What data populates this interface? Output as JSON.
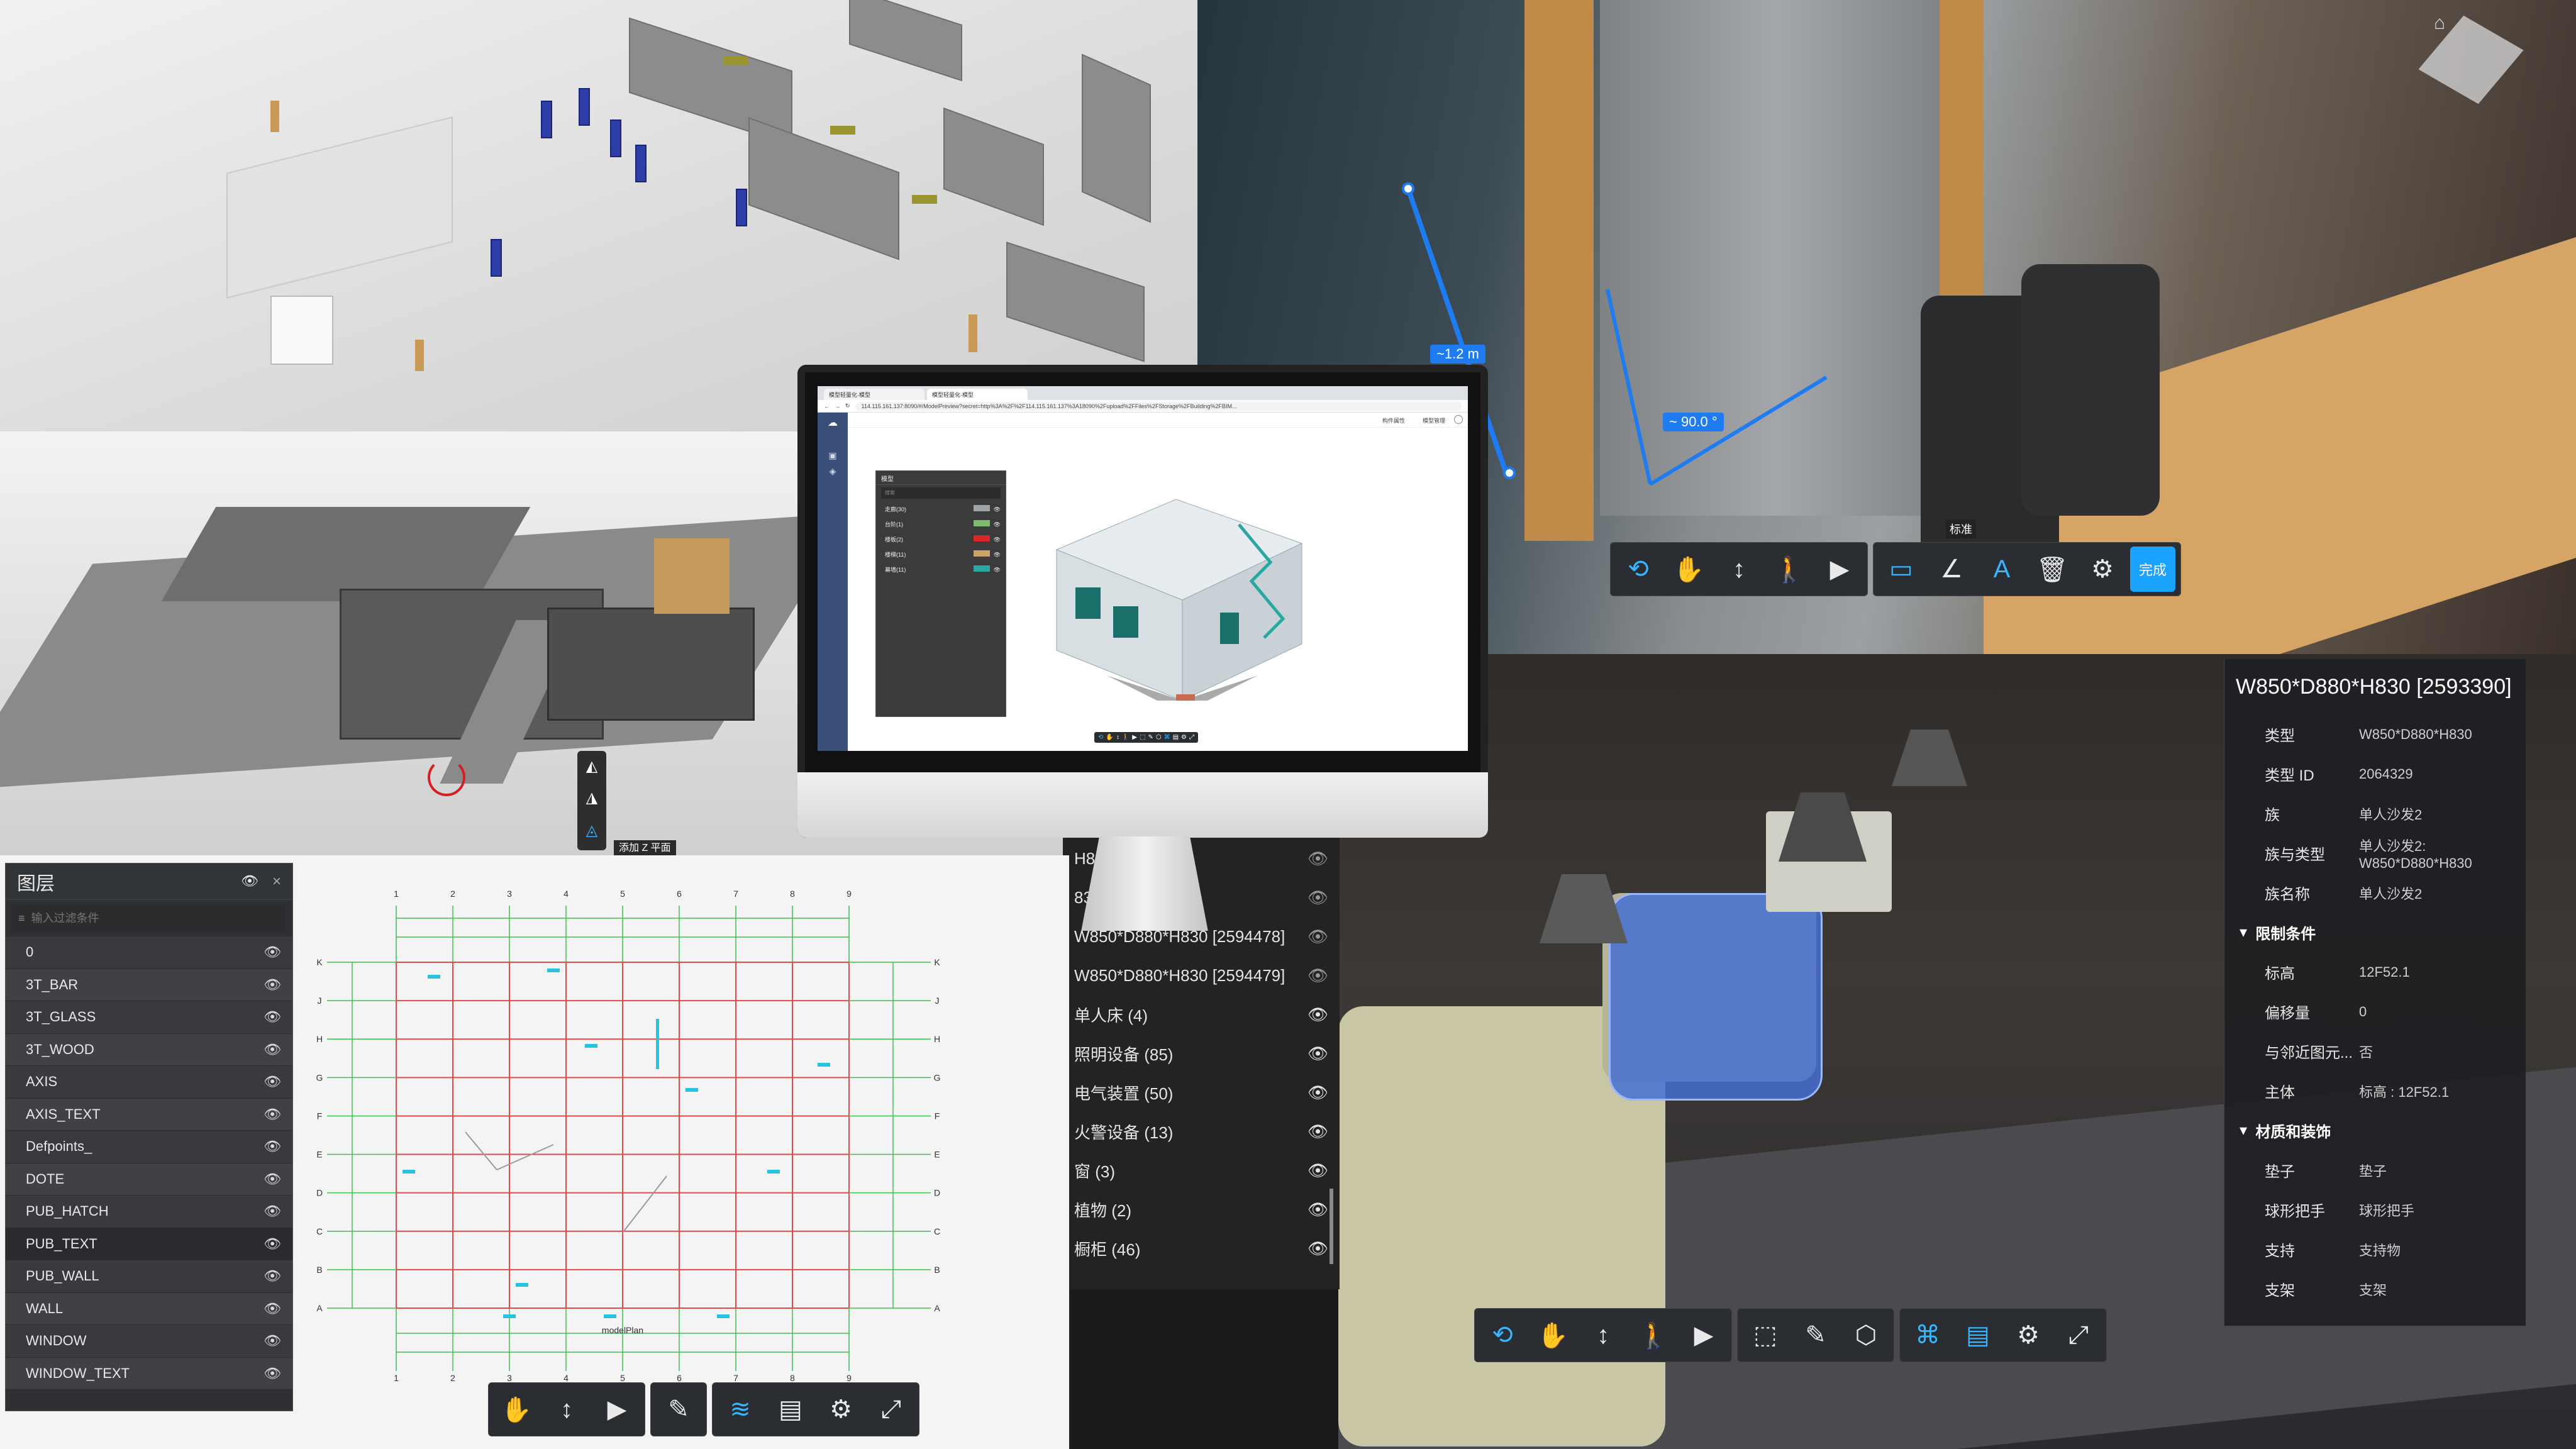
{
  "layer_panel": {
    "title": "图层",
    "search_placeholder": "输入过滤条件",
    "layers": [
      "0",
      "3T_BAR",
      "3T_GLASS",
      "3T_WOOD",
      "AXIS",
      "AXIS_TEXT",
      "Defpoints_",
      "DOTE",
      "PUB_HATCH",
      "PUB_TEXT",
      "PUB_WALL",
      "WALL",
      "WINDOW",
      "WINDOW_TEXT"
    ],
    "selected": "PUB_TEXT"
  },
  "model_toolbar_tooltip": "添加 Z 平面",
  "measurement": {
    "length_label": "~1.2 m",
    "angle_label": "~ 90.0 °",
    "tooltip": "标准"
  },
  "top_right_toolbar": {
    "done_label": "完成"
  },
  "monitor": {
    "tabs": [
      "模型轻量化·模型",
      "模型轻量化·模型"
    ],
    "url": "114.115.161.137:8090/#/ModelPreview?secret=http%3A%2F%2F114.115.161.137%3A18090%2Fupload%2FFiles%2FStorage%2FBuilding%2FBIM...",
    "top_right_labels": [
      "构件属性",
      "模型管理"
    ],
    "panel_title": "模型",
    "panel_search": "搜索",
    "panel_rows": [
      {
        "label": "走廊(30)",
        "color": "#9fa4a6"
      },
      {
        "label": "台阶(1)",
        "color": "#7fb870"
      },
      {
        "label": "楼板(2)",
        "color": "#d92626"
      },
      {
        "label": "楼梯(11)",
        "color": "#c8a46a"
      },
      {
        "label": "幕墙(11)",
        "color": "#2aa7a0"
      }
    ]
  },
  "type_list": {
    "rows": [
      {
        "label": "H830 [2594226]",
        "eye": false
      },
      {
        "label": "830 [2594227]",
        "eye": false
      },
      {
        "label": "W850*D880*H830 [2594478]",
        "eye": false
      },
      {
        "label": "W850*D880*H830 [2594479]",
        "eye": false
      },
      {
        "label": "单人床 (4)",
        "eye": true
      },
      {
        "label": "照明设备 (85)",
        "eye": true
      },
      {
        "label": "电气装置 (50)",
        "eye": true
      },
      {
        "label": "火警设备 (13)",
        "eye": true
      },
      {
        "label": "窗 (3)",
        "eye": true
      },
      {
        "label": "植物 (2)",
        "eye": true
      },
      {
        "label": "橱柜 (46)",
        "eye": true
      }
    ]
  },
  "properties": {
    "title": "W850*D880*H830 [2593390]",
    "rows_top": [
      {
        "k": "类型",
        "v": "W850*D880*H830"
      },
      {
        "k": "类型 ID",
        "v": "2064329"
      },
      {
        "k": "族",
        "v": "单人沙发2"
      },
      {
        "k": "族与类型",
        "v": "单人沙发2: W850*D880*H830"
      },
      {
        "k": "族名称",
        "v": "单人沙发2"
      }
    ],
    "section1": "限制条件",
    "rows_mid": [
      {
        "k": "标高",
        "v": "12F52.1"
      },
      {
        "k": "偏移量",
        "v": "0"
      },
      {
        "k": "与邻近图元...",
        "v": "否"
      },
      {
        "k": "主体",
        "v": "标高 : 12F52.1"
      }
    ],
    "section2": "材质和装饰",
    "rows_bottom": [
      {
        "k": "垫子",
        "v": "垫子"
      },
      {
        "k": "球形把手",
        "v": "球形把手"
      },
      {
        "k": "支持",
        "v": "支持物"
      },
      {
        "k": "支架",
        "v": "支架"
      }
    ]
  },
  "plan": {
    "title_text": "modelPlan",
    "col_labels": [
      "1",
      "2",
      "3",
      "4",
      "5",
      "6",
      "7",
      "8",
      "9"
    ],
    "row_labels": [
      "K",
      "J",
      "H",
      "G",
      "F",
      "E",
      "D",
      "C",
      "B",
      "A"
    ]
  }
}
